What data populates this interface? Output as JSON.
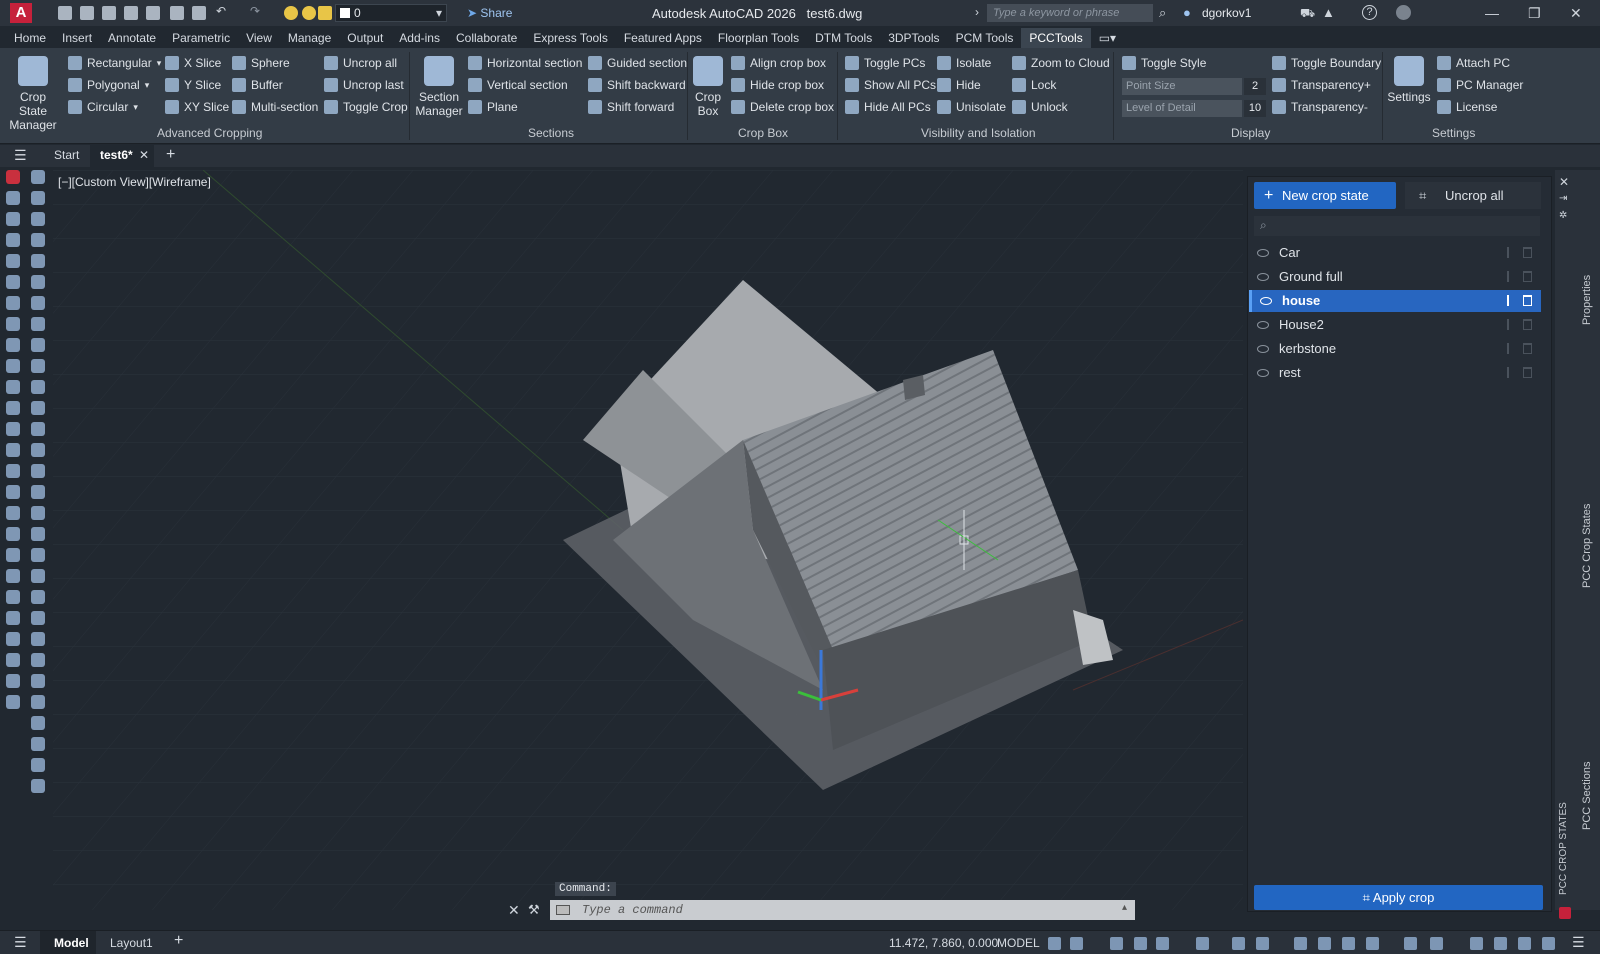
{
  "app": {
    "title": "Autodesk AutoCAD 2026",
    "file": "test6.dwg",
    "logo_letter": "A",
    "layer": "0",
    "share": "Share",
    "search_placeholder": "Type a keyword or phrase",
    "user": "dgorkov1",
    "brand_color": "#c6213b",
    "accent_color": "#2266c2"
  },
  "tabs": [
    "Home",
    "Insert",
    "Annotate",
    "Parametric",
    "View",
    "Manage",
    "Output",
    "Add-ins",
    "Collaborate",
    "Express Tools",
    "Featured Apps",
    "Floorplan Tools",
    "DTM Tools",
    "3DPTools",
    "PCM Tools",
    "PCCTools"
  ],
  "active_tab": "PCCTools",
  "ribbon": {
    "advanced_cropping": {
      "label": "Advanced Cropping",
      "big": "Crop State Manager",
      "items": [
        "Rectangular",
        "Polygonal",
        "Circular",
        "X Slice",
        "Y Slice",
        "XY Slice",
        "Sphere",
        "Buffer",
        "Multi-section",
        "Uncrop all",
        "Uncrop last",
        "Toggle Crop"
      ]
    },
    "sections": {
      "label": "Sections",
      "big": "Section Manager",
      "items": [
        "Horizontal section",
        "Vertical section",
        "Plane",
        "Guided section",
        "Shift backward",
        "Shift forward"
      ]
    },
    "crop_box": {
      "label": "Crop Box",
      "big": "Crop Box",
      "items": [
        "Align crop box",
        "Hide crop box",
        "Delete crop box"
      ]
    },
    "visibility": {
      "label": "Visibility and Isolation",
      "items": [
        "Toggle PCs",
        "Show All PCs",
        "Hide All PCs",
        "Isolate",
        "Hide",
        "Unisolate",
        "Zoom to Cloud",
        "Lock",
        "Unlock"
      ]
    },
    "display": {
      "label": "Display",
      "point_size_label": "Point Size",
      "point_size": "2",
      "lod_label": "Level of Detail",
      "lod": "10",
      "items": [
        "Toggle Style",
        "Toggle Boundary",
        "Transparency+",
        "Transparency-"
      ]
    },
    "settings": {
      "label": "Settings",
      "big": "Settings",
      "items": [
        "Attach PC",
        "PC Manager",
        "License"
      ]
    }
  },
  "filetabs": {
    "start": "Start",
    "active": "test6*"
  },
  "viewport": {
    "label": "[−][Custom View][Wireframe]"
  },
  "command": {
    "label": "Command:",
    "placeholder": "Type a command"
  },
  "crop_panel": {
    "new_button": "New crop state",
    "uncrop_button": "Uncrop all",
    "states": [
      "Car",
      "Ground full",
      "house",
      "House2",
      "kerbstone",
      "rest"
    ],
    "selected": "house",
    "apply_button": "Apply crop"
  },
  "side_tabs": [
    "Properties",
    "PCC Crop States",
    "PCC Sections",
    "PCC CROP STATES"
  ],
  "status": {
    "model_tab": "Model",
    "layout_tab": "Layout1",
    "coords": "11.472, 7.860, 0.000",
    "mode": "MODEL"
  }
}
